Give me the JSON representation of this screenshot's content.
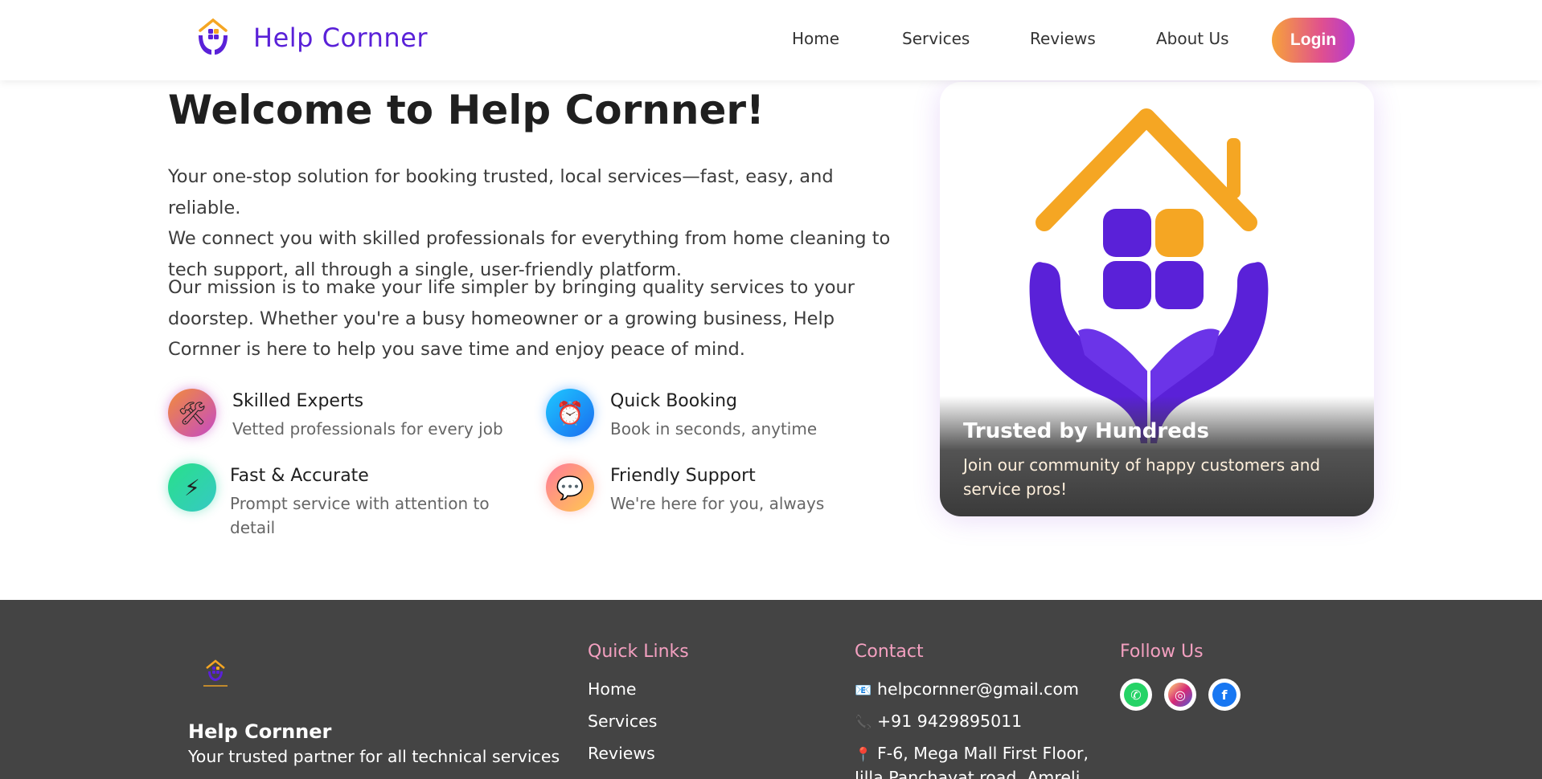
{
  "header": {
    "brand": "Help Cornner",
    "nav": [
      "Home",
      "Services",
      "Reviews",
      "About Us"
    ],
    "login_label": "Login"
  },
  "hero": {
    "title": "Welcome to Help Cornner!",
    "para1_lines": [
      "Your one-stop solution for booking trusted, local services—fast, easy, and reliable.",
      "We connect you with skilled professionals for everything from home cleaning to",
      "tech support, all through a single, user-friendly platform."
    ],
    "para2_lines": [
      "Our mission is to make your life simpler by bringing quality services to your",
      "doorstep. Whether you're a busy homeowner or a growing business, Help",
      "Cornner is here to help you save time and enjoy peace of mind."
    ],
    "features": [
      {
        "title": "Skilled Experts",
        "desc": "Vetted professionals for every job",
        "icon": "tools-icon"
      },
      {
        "title": "Quick Booking",
        "desc": "Book in seconds, anytime",
        "icon": "alarm-clock-icon"
      },
      {
        "title": "Fast & Accurate",
        "desc_lines": [
          "Prompt service with attention to",
          "detail"
        ],
        "icon": "lightning-icon"
      },
      {
        "title": "Friendly Support",
        "desc": "We're here for you, always",
        "icon": "speech-bubble-icon"
      }
    ]
  },
  "card": {
    "title": "Trusted by Hundreds",
    "text_lines": [
      "Join our community of happy customers and",
      "service pros!"
    ]
  },
  "footer": {
    "brand": "Help Cornner",
    "tagline": "Your trusted partner for all technical services",
    "quick_links_heading": "Quick Links",
    "quick_links": [
      "Home",
      "Services",
      "Reviews"
    ],
    "contact_heading": "Contact",
    "contact": {
      "email": "helpcornner@gmail.com",
      "phone": "+91 9429895011",
      "address": "F-6, Mega Mall First Floor,",
      "address2": "Jilla Panchayat road, Amreli"
    },
    "follow_heading": "Follow Us",
    "social": [
      "whatsapp-icon",
      "instagram-icon",
      "facebook-icon"
    ]
  },
  "colors": {
    "brand_purple": "#5a21d8",
    "accent_orange": "#f5a623",
    "footer_bg": "#444444",
    "footer_heading": "#f3a0c0"
  }
}
